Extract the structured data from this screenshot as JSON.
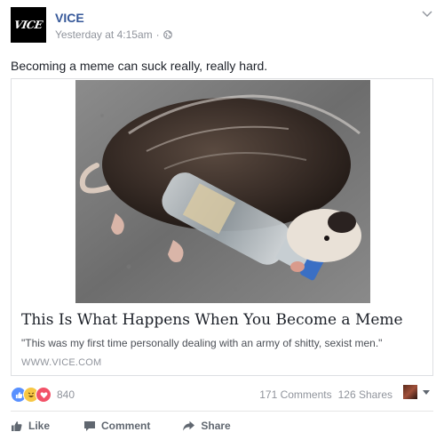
{
  "post": {
    "page_name": "VICE",
    "avatar_text": "VICE",
    "timestamp": "Yesterday at 4:15am",
    "separator": "·",
    "privacy_icon": "globe-icon",
    "text": "Becoming a meme can suck really, really hard."
  },
  "link": {
    "image_alt": "opossum lying next to a bottle",
    "title": "This Is What Happens When You Become a Meme",
    "description": "\"This was my first time personally dealing with an army of shitty, sexist men.\"",
    "domain": "WWW.VICE.COM"
  },
  "stats": {
    "reaction_icons": [
      "like-icon",
      "haha-icon",
      "love-icon"
    ],
    "reaction_count": "840",
    "comments": "171 Comments",
    "shares": "126 Shares"
  },
  "actions": {
    "like": "Like",
    "comment": "Comment",
    "share": "Share"
  },
  "colors": {
    "link_blue": "#365899",
    "meta_gray": "#90949c",
    "like_blue": "#5890ff",
    "love_red": "#f25268",
    "haha_yellow": "#f7c744"
  }
}
